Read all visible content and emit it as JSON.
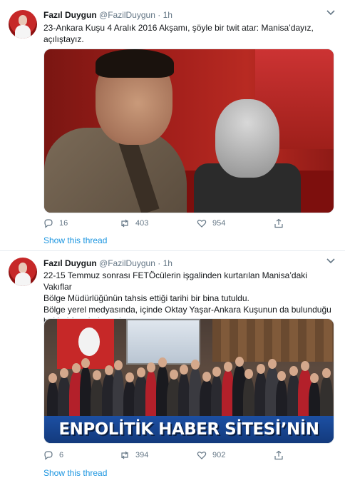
{
  "tweets": [
    {
      "name": "Fazıl Duygun",
      "handle": "@FazilDuygun",
      "dot": "·",
      "time": "1h",
      "text_lines": [
        "23-Ankara Kuşu 4 Aralık 2016 Akşamı, şöyle bir twit atar:  Manisa’dayız,",
        "açılıştayız."
      ],
      "replies": "16",
      "retweets": "403",
      "likes": "954",
      "show_thread": "Show this thread"
    },
    {
      "name": "Fazıl Duygun",
      "handle": "@FazilDuygun",
      "dot": "·",
      "time": "1h",
      "text_lines": [
        "22-15 Temmuz sonrası FETÖcülerin işgalinden kurtarılan Manisa’daki Vakıflar",
        "Bölge Müdürlüğünün tahsis ettiği tarihi bir bina tutuldu.",
        "Bölge yerel medyasında, içinde Oktay Yaşar-Ankara Kuşunun da bulunduğu",
        "bol bol foto-haber çıkar."
      ],
      "media_banner": "ENPOLİTİK HABER SİTESİ’NİN",
      "replies": "6",
      "retweets": "394",
      "likes": "902",
      "show_thread": "Show this thread"
    }
  ],
  "icons": {
    "caret": "chevron-down-icon",
    "reply": "reply-icon",
    "retweet": "retweet-icon",
    "like": "heart-icon",
    "share": "share-icon"
  },
  "colors": {
    "link": "#1b95e0",
    "muted": "#657786",
    "divider": "#e6ecf0"
  }
}
